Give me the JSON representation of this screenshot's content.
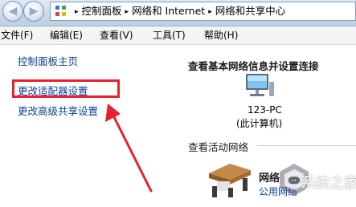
{
  "toolbar": {
    "back_glyph": "◀",
    "forward_glyph": "▶",
    "back_icon": "back-arrow-icon",
    "forward_icon": "forward-arrow-icon"
  },
  "address_bar": {
    "icon": "control-panel-icon",
    "breadcrumbs": [
      "控制面板",
      "网络和 Internet",
      "网络和共享中心"
    ],
    "separator": "▸"
  },
  "menu": {
    "items": [
      "文件(F)",
      "编辑(E)",
      "查看(V)",
      "工具(T)",
      "帮助(H)"
    ]
  },
  "sidebar": {
    "links": [
      "控制面板主页",
      "更改适配器设置",
      "更改高级共享设置"
    ],
    "highlight_color": "#e8212d"
  },
  "main": {
    "title": "查看基本网络信息并设置连接",
    "computer": {
      "icon": "computer-monitor-icon",
      "name": "123-PC",
      "subtitle": "(此计算机)"
    },
    "active_networks_label": "查看活动网络",
    "network": {
      "icon": "network-bench-icon",
      "name": "网络",
      "type": "公用网络"
    }
  },
  "watermark": {
    "icon": "watermark-logo-icon",
    "text": "系统之家"
  },
  "colors": {
    "link": "#0a3f9a",
    "annotation_red": "#e8212d"
  }
}
